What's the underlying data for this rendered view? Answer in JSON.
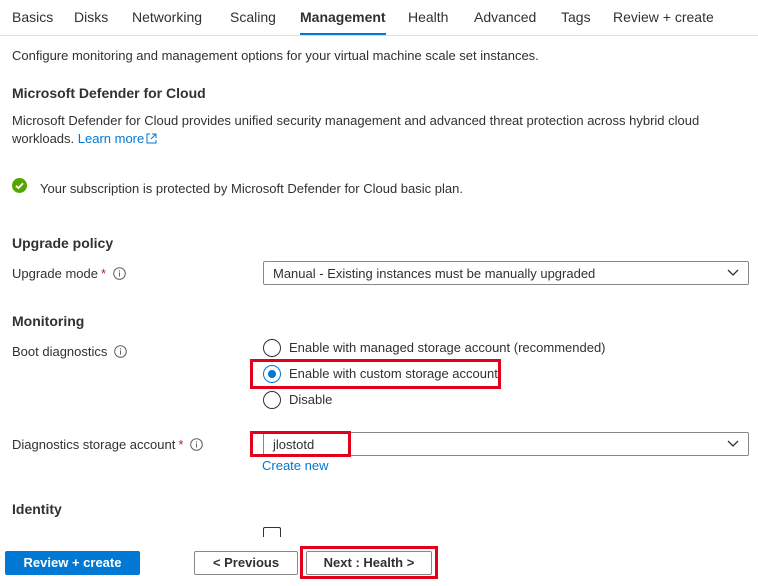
{
  "tabs": [
    {
      "label": "Basics"
    },
    {
      "label": "Disks"
    },
    {
      "label": "Networking"
    },
    {
      "label": "Scaling"
    },
    {
      "label": "Management",
      "active": true
    },
    {
      "label": "Health"
    },
    {
      "label": "Advanced"
    },
    {
      "label": "Tags"
    },
    {
      "label": "Review + create"
    }
  ],
  "intro": "Configure monitoring and management options for your virtual machine scale set instances.",
  "defender": {
    "heading": "Microsoft Defender for Cloud",
    "description": "Microsoft Defender for Cloud provides unified security management and advanced threat protection across hybrid cloud workloads.",
    "learn_more": "Learn more",
    "status": "Your subscription is protected by Microsoft Defender for Cloud basic plan."
  },
  "upgrade": {
    "heading": "Upgrade policy",
    "mode_label": "Upgrade mode",
    "required_mark": "*",
    "mode_value": "Manual - Existing instances must be manually upgraded"
  },
  "monitoring": {
    "heading": "Monitoring",
    "boot_label": "Boot diagnostics",
    "options": [
      {
        "label": "Enable with managed storage account (recommended)",
        "selected": false
      },
      {
        "label": "Enable with custom storage account",
        "selected": true
      },
      {
        "label": "Disable",
        "selected": false
      }
    ],
    "storage_label": "Diagnostics storage account",
    "required_mark": "*",
    "storage_value": "jlostotd",
    "create_new": "Create new"
  },
  "identity": {
    "heading": "Identity"
  },
  "footer": {
    "review": "Review + create",
    "previous": "< Previous",
    "next": "Next : Health >"
  },
  "colors": {
    "accent": "#0078d4",
    "highlight": "#e3001b",
    "success": "#57a300"
  }
}
